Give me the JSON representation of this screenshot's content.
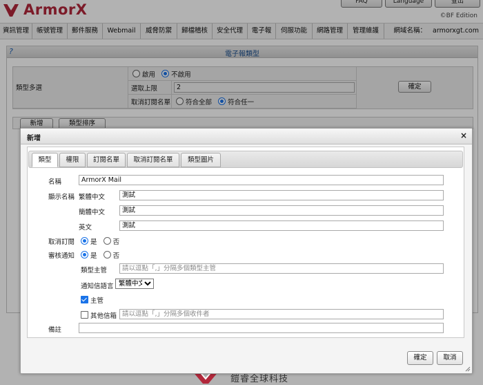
{
  "header": {
    "brand": "ArmorX",
    "top_buttons": [
      "FAQ",
      "Language",
      "登出"
    ],
    "edition": "©BF Edition"
  },
  "menu": {
    "items": [
      "資訊管理",
      "帳號管理",
      "郵件服務",
      "Webmail",
      "威脅防禦",
      "歸檔稽核",
      "安全代理",
      "電子報",
      "伺服功能",
      "網路管理",
      "管理維護"
    ],
    "domain_label": "網域名稱：",
    "domain_value": "armorxgt.com"
  },
  "page": {
    "help": "?",
    "title": "電子報類型",
    "multi_type_label": "類型多選",
    "enable_label": "啟用",
    "disable_label": "不啟用",
    "max_select_label": "選取上限",
    "max_select_value": "2",
    "unsub_list_label": "取消訂閱名單",
    "match_all_label": "符合全部",
    "match_any_label": "符合任一",
    "confirm_label": "確定",
    "add_tab": "新增",
    "sort_tab": "類型排序"
  },
  "dialog": {
    "title": "新增",
    "close": "×",
    "tabs": [
      "類型",
      "權限",
      "訂閱名單",
      "取消訂閱名單",
      "類型圖片"
    ],
    "active_tab": "類型",
    "name_label": "名稱",
    "name_value": "ArmorX Mail",
    "display_name_label": "顯示名稱",
    "lang_traditional": "繁體中文",
    "lang_traditional_value": "測試",
    "lang_simplified": "簡體中文",
    "lang_simplified_value": "測試",
    "lang_english": "英文",
    "lang_english_value": "測試",
    "unsubscribe_label": "取消訂閱",
    "review_notify_label": "審核通知",
    "yes": "是",
    "no": "否",
    "type_manager_label": "類型主管",
    "type_manager_placeholder": "請以逗點「,」分隔多個類型主管",
    "notify_lang_label": "通知信語言",
    "notify_lang_value": "繁體中文",
    "supervisor_label": "主管",
    "other_mailbox_label": "其他信箱",
    "other_mailbox_placeholder": "請以逗點「,」分隔多個收件者",
    "remark_label": "備註",
    "remark_value": "",
    "ok_label": "確定",
    "cancel_label": "取消"
  },
  "footer": {
    "company": "鎧睿全球科技"
  },
  "colors": {
    "brand_red": "#b2283b",
    "accent_blue": "#1a73e8",
    "title_blue": "#1b4f8f"
  }
}
